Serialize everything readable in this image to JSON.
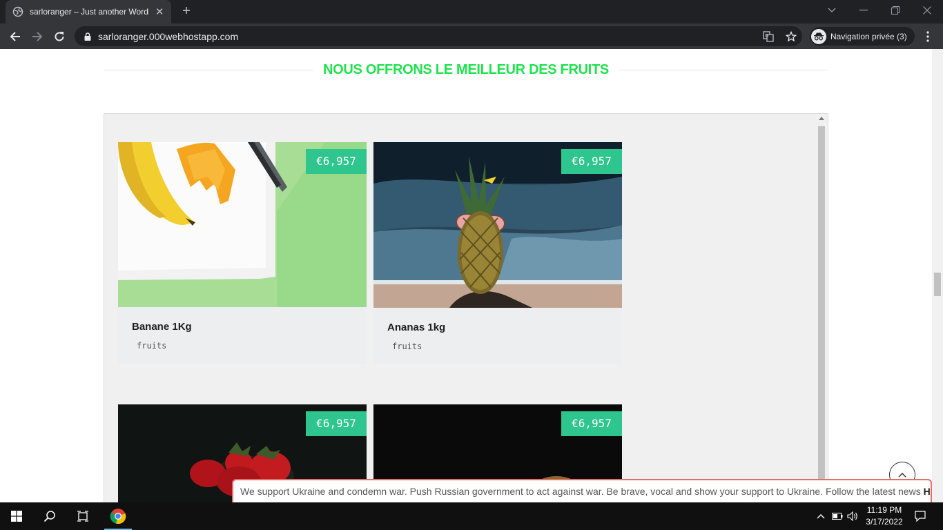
{
  "browser": {
    "tab_title": "sarloranger – Just another WordPress site",
    "new_tab": "+",
    "url": "sarloranger.000webhostapp.com",
    "incognito_label": "Navigation privée (3)"
  },
  "page": {
    "heading": "NOUS OFFRONS LE MEILLEUR DES FRUITS",
    "accent_color": "#1ee34d",
    "badge_color": "#2ec58e",
    "products": [
      {
        "price": "€6,957",
        "name": "Banane 1Kg",
        "category": "fruits"
      },
      {
        "price": "€6,957",
        "name": "Ananas 1kg",
        "category": "fruits"
      },
      {
        "price": "€6,957",
        "name": "",
        "category": ""
      },
      {
        "price": "€6,957",
        "name": "",
        "category": ""
      }
    ],
    "notice": {
      "text": "We support Ukraine and condemn war. Push Russian government to act against war. Be brave, vocal and show your support to Ukraine. Follow the latest news",
      "link": "HERE"
    }
  },
  "taskbar": {
    "time": "11:19 PM",
    "date": "3/17/2022"
  }
}
